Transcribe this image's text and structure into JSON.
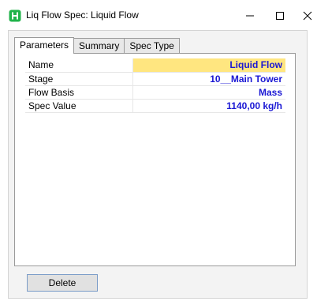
{
  "window": {
    "title": "Liq Flow Spec: Liquid Flow",
    "icon": "hysys-icon",
    "accent_color": "#21b34b"
  },
  "tabs": [
    {
      "label": "Parameters",
      "active": true
    },
    {
      "label": "Summary",
      "active": false
    },
    {
      "label": "Spec Type",
      "active": false
    }
  ],
  "parameters": [
    {
      "label": "Name",
      "value": "Liquid Flow",
      "selected": true
    },
    {
      "label": "Stage",
      "value": "10__Main Tower",
      "selected": false
    },
    {
      "label": "Flow Basis",
      "value": "Mass",
      "selected": false
    },
    {
      "label": "Spec Value",
      "value": "1140,00 kg/h",
      "selected": false
    }
  ],
  "buttons": {
    "delete_label": "Delete"
  },
  "colors": {
    "value_text": "#1a17d4",
    "selected_cell": "#ffe680"
  }
}
